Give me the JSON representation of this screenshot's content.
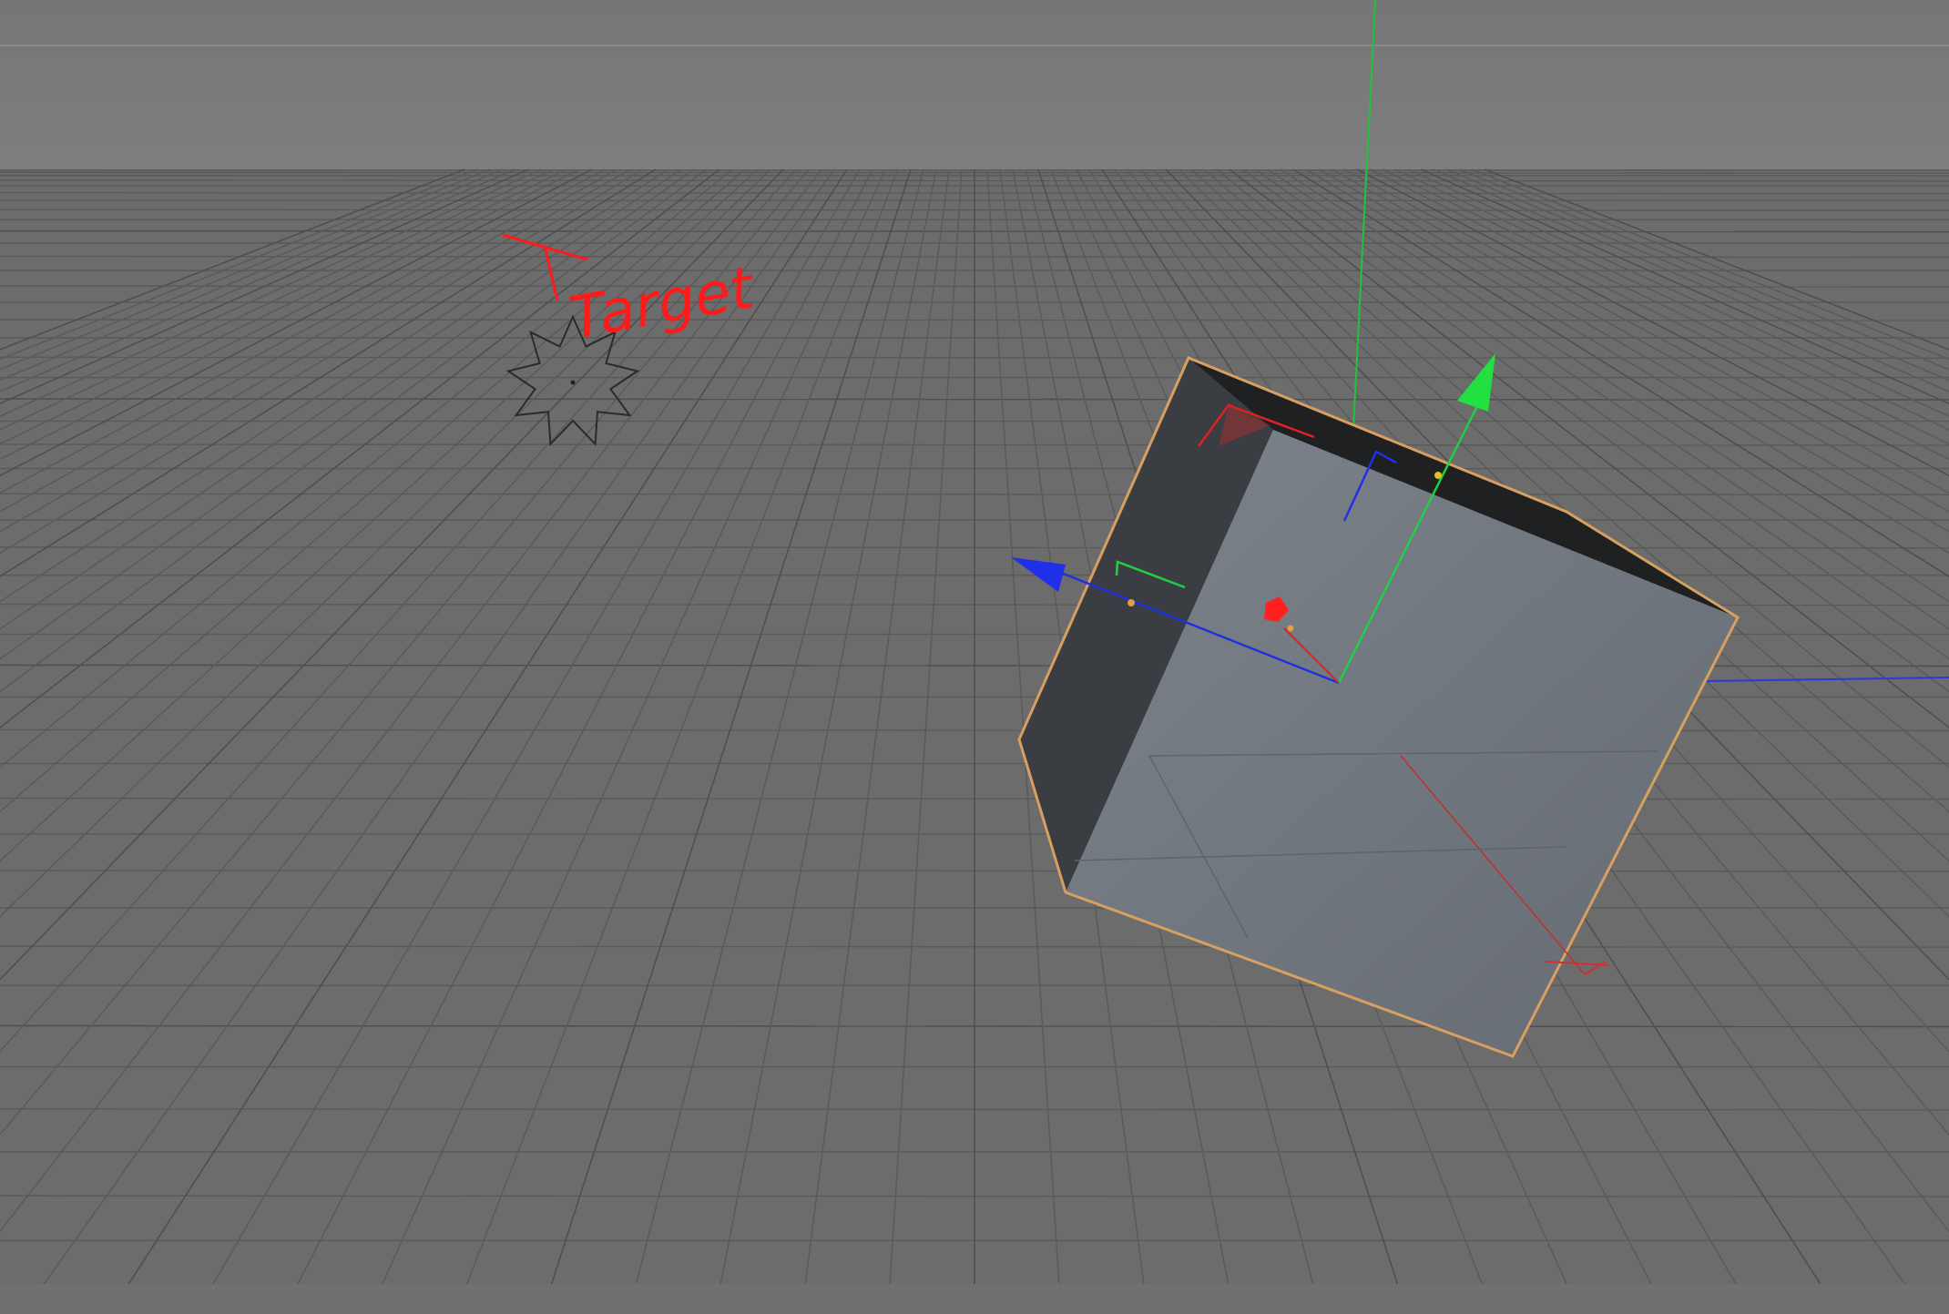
{
  "viewport": {
    "colors": {
      "background": "#6e6e6e",
      "horizon": "#7b7b7b",
      "grid_line": "#585858",
      "grid_major": "#4e4e4e",
      "cube_face_top": "#6d7379",
      "cube_face_side": "#3a3c3f",
      "cube_face_back": "#1f2123",
      "selection_outline": "#d8a060",
      "axis_x": "#e02020",
      "axis_y": "#20d040",
      "axis_z": "#2030e8",
      "annotation": "#ff1a1a"
    },
    "annotation": {
      "text": "Target"
    },
    "objects": {
      "target": {
        "icon": "star-null-icon"
      },
      "cube": {
        "icon": "cube-icon",
        "selected": true
      },
      "gizmo": {
        "icon": "move-gizmo-icon"
      }
    }
  }
}
